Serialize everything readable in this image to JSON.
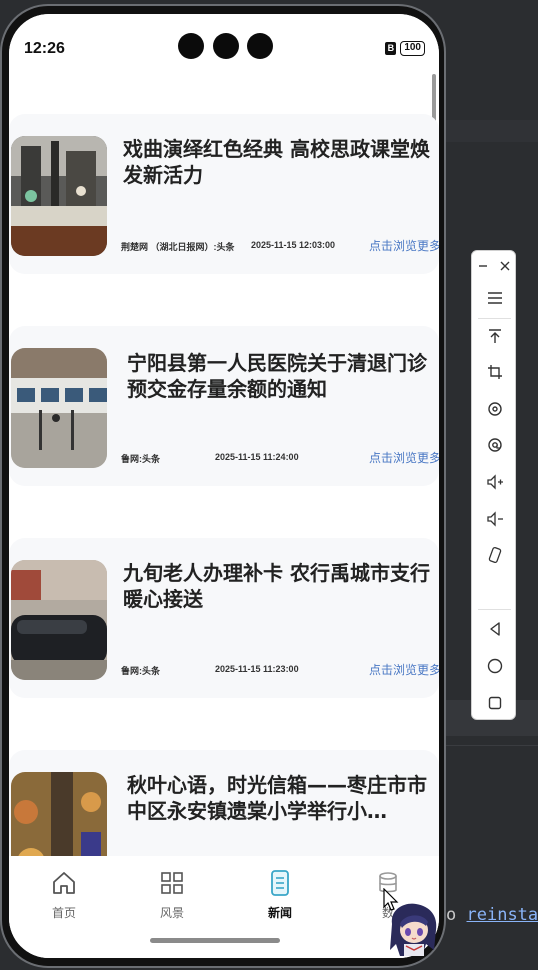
{
  "status_bar": {
    "time": "12:26",
    "sim_label": "B",
    "battery": "100"
  },
  "news": [
    {
      "title": "戏曲演绎红色经典 高校思政课堂焕发新活力",
      "source": "荆楚网 （湖北日报网）:头条",
      "time": "2025-11-15 12:03:00",
      "more": "点击浏览更多"
    },
    {
      "title": "宁阳县第一人民医院关于清退门诊预交金存量余额的通知",
      "source": "鲁网:头条",
      "time": "2025-11-15 11:24:00",
      "more": "点击浏览更多"
    },
    {
      "title": "九旬老人办理补卡 农行禹城市支行暖心接送",
      "source": "鲁网:头条",
      "time": "2025-11-15 11:23:00",
      "more": "点击浏览更多"
    },
    {
      "title": "秋叶心语，时光信箱——枣庄市市中区永安镇遗棠小学举行小…",
      "source": "",
      "time": "",
      "more": ""
    }
  ],
  "tabs": [
    {
      "label": "首页",
      "icon": "home-icon",
      "active": false
    },
    {
      "label": "风景",
      "icon": "grid-icon",
      "active": false
    },
    {
      "label": "新闻",
      "icon": "document-icon",
      "active": true
    },
    {
      "label": "数",
      "icon": "database-icon",
      "active": false
    }
  ],
  "toolbar": {
    "items": [
      "minimize-icon",
      "close-icon",
      "menu-icon",
      "pin-top-icon",
      "crop-icon",
      "rotate-icon",
      "rotate-alt-icon",
      "volume-up-icon",
      "volume-down-icon",
      "shake-icon",
      "back-icon",
      "home-circle-icon",
      "recents-icon"
    ]
  },
  "ide": {
    "text_plain": "o",
    "text_link": "reinsta"
  },
  "colors": {
    "accent": "#4a78c4",
    "active_tab": "#3aa6c8"
  }
}
